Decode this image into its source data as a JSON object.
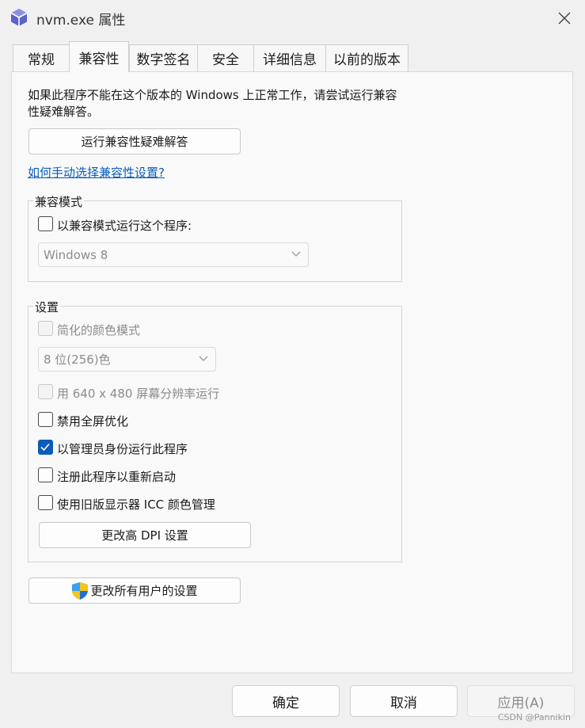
{
  "window": {
    "title": "nvm.exe 属性"
  },
  "tabs": [
    {
      "label": "常规"
    },
    {
      "label": "兼容性"
    },
    {
      "label": "数字签名"
    },
    {
      "label": "安全"
    },
    {
      "label": "详细信息"
    },
    {
      "label": "以前的版本"
    }
  ],
  "compat": {
    "intro": "如果此程序不能在这个版本的 Windows 上正常工作，请尝试运行兼容性疑难解答。",
    "troubleshoot_button": "运行兼容性疑难解答",
    "manual_link": "如何手动选择兼容性设置?",
    "mode_group": {
      "legend": "兼容模式",
      "checkbox_label": "以兼容模式运行这个程序:",
      "checked": false,
      "os_select_value": "Windows 8"
    },
    "settings_group": {
      "legend": "设置",
      "reduced_color_label": "简化的颜色模式",
      "color_select_value": "8 位(256)色",
      "res_640_label": "用 640 x 480 屏幕分辨率运行",
      "disable_fullscreen_label": "禁用全屏优化",
      "run_as_admin_label": "以管理员身份运行此程序",
      "register_restart_label": "注册此程序以重新启动",
      "legacy_icc_label": "使用旧版显示器 ICC 颜色管理",
      "dpi_button": "更改高 DPI 设置"
    },
    "all_users_button": "更改所有用户的设置"
  },
  "footer": {
    "ok": "确定",
    "cancel": "取消",
    "apply": "应用(A)"
  },
  "watermark": "CSDN @Pannikin",
  "colors": {
    "accent": "#0a5cba",
    "link": "#0a5cba",
    "disabled": "#8c8c8c"
  }
}
